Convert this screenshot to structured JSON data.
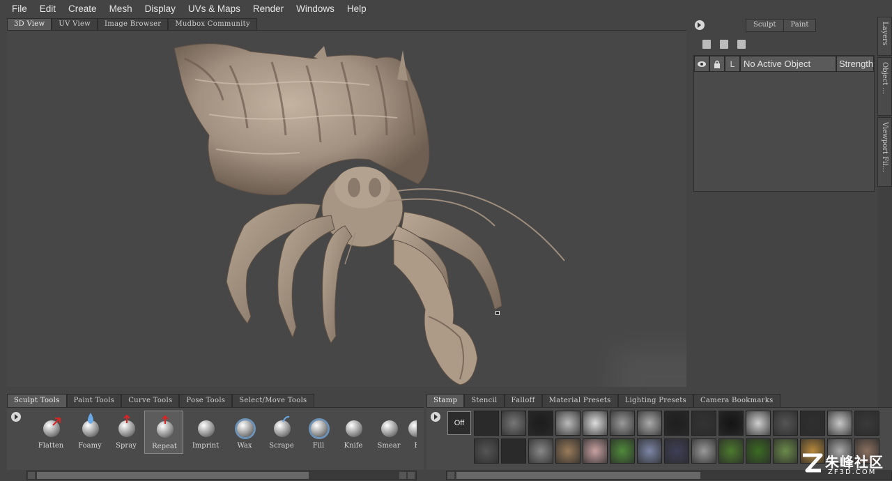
{
  "menu": [
    "File",
    "Edit",
    "Create",
    "Mesh",
    "Display",
    "UVs & Maps",
    "Render",
    "Windows",
    "Help"
  ],
  "viewport_tabs": [
    "3D View",
    "UV View",
    "Image Browser",
    "Mudbox Community"
  ],
  "right_panel": {
    "mode_tabs": [
      "Sculpt",
      "Paint"
    ],
    "layers_header": {
      "lock_label": "L",
      "name": "No Active Object",
      "strength": "Strength"
    }
  },
  "side_tabs": [
    "Layers",
    "Object ...",
    "Viewport Fil..."
  ],
  "tool_tabs": [
    "Sculpt Tools",
    "Paint Tools",
    "Curve Tools",
    "Pose Tools",
    "Select/Move Tools"
  ],
  "tools": [
    "Flatten",
    "Foamy",
    "Spray",
    "Repeat",
    "Imprint",
    "Wax",
    "Scrape",
    "Fill",
    "Knife",
    "Smear",
    "B"
  ],
  "selected_tool": "Repeat",
  "stamp_tabs": [
    "Stamp",
    "Stencil",
    "Falloff",
    "Material Presets",
    "Lighting Presets",
    "Camera Bookmarks"
  ],
  "stamp_off_label": "Off",
  "watermark": {
    "cn": "朱峰社区",
    "en": "ZF3D.COM"
  },
  "colors": {
    "model": "#a89684",
    "background": "#474747",
    "panel": "#444444"
  }
}
